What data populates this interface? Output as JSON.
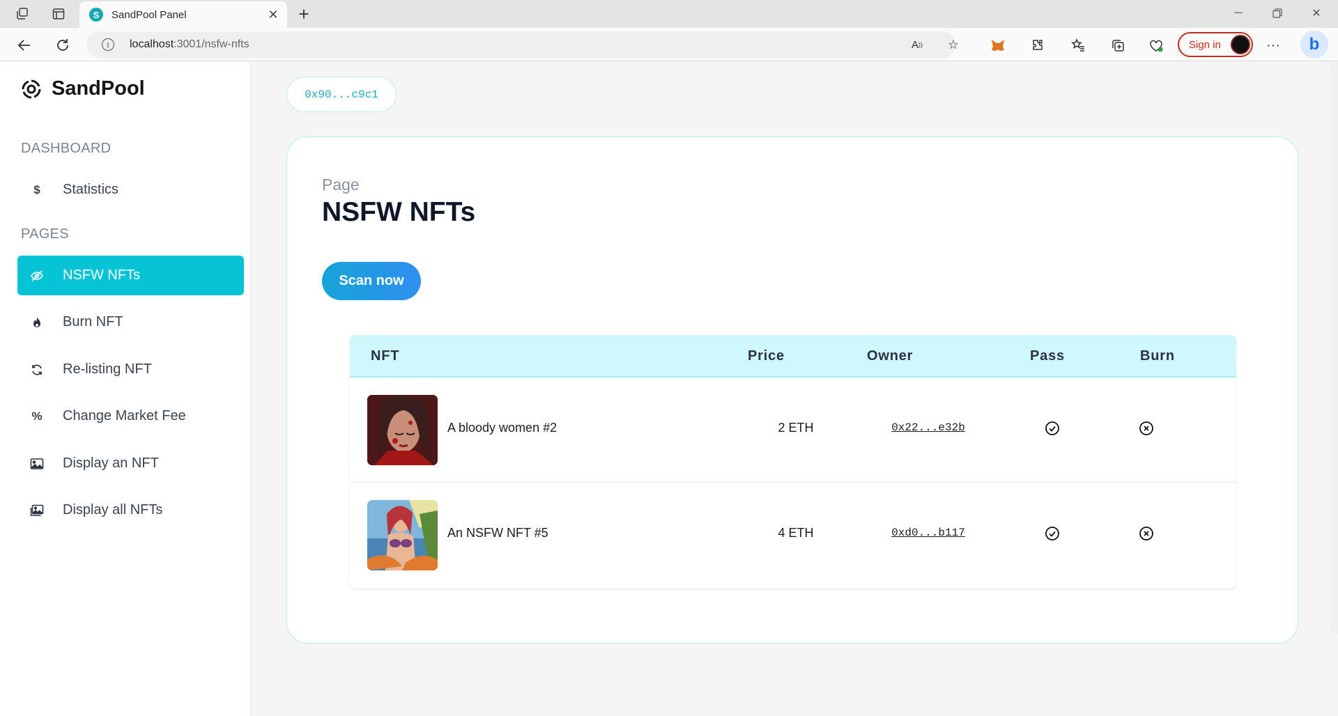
{
  "browser": {
    "tab_title": "SandPool Panel",
    "tab_favicon_letter": "S",
    "url_host": "localhost",
    "url_path": ":3001/nsfw-nfts",
    "sign_in_label": "Sign in"
  },
  "brand": {
    "name": "SandPool"
  },
  "sidebar": {
    "section_dashboard": "DASHBOARD",
    "section_pages": "PAGES",
    "statistics": {
      "label": "Statistics",
      "icon": "dollar-icon"
    },
    "items": [
      {
        "label": "NSFW NFTs",
        "icon": "eye-slash-icon",
        "active": true
      },
      {
        "label": "Burn NFT",
        "icon": "fire-icon",
        "active": false
      },
      {
        "label": "Re-listing NFT",
        "icon": "refresh-icon",
        "active": false
      },
      {
        "label": "Change Market Fee",
        "icon": "percent-icon",
        "active": false
      },
      {
        "label": "Display an NFT",
        "icon": "image-icon",
        "active": false
      },
      {
        "label": "Display all NFTs",
        "icon": "images-icon",
        "active": false
      }
    ]
  },
  "main": {
    "wallet_address": "0x90...c9c1",
    "page_kicker": "Page",
    "page_title": "NSFW NFTs",
    "scan_button": "Scan now",
    "table": {
      "headers": {
        "nft": "NFT",
        "price": "Price",
        "owner": "Owner",
        "pass": "Pass",
        "burn": "Burn"
      },
      "rows": [
        {
          "name": "A bloody women #2",
          "price": "2 ETH",
          "owner": "0x22...e32b"
        },
        {
          "name": "An NSFW NFT #5",
          "price": "4 ETH",
          "owner": "0xd0...b117"
        }
      ]
    }
  },
  "colors": {
    "accent": "#06c4d6",
    "header_bg": "#cff8fd",
    "scan_gradient_start": "#16a4d8",
    "scan_gradient_end": "#2f8ff0"
  }
}
